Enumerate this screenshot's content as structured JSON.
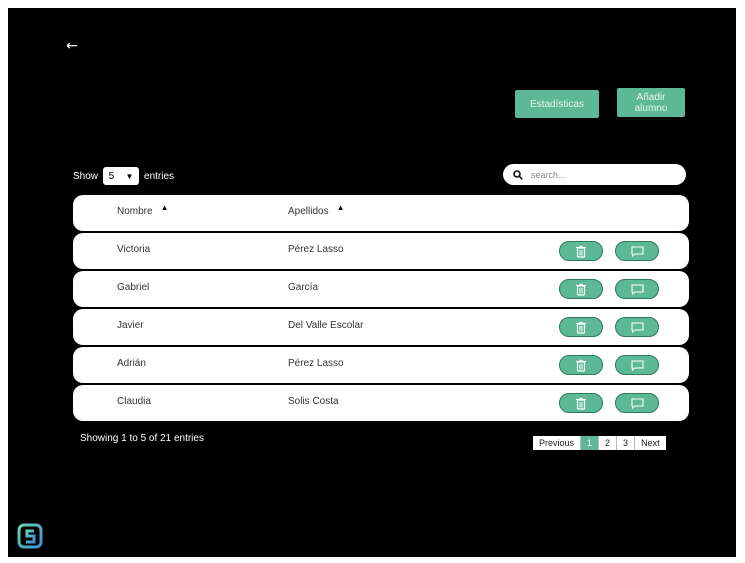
{
  "header": {
    "back_icon": "arrow-left-icon",
    "stats_label": "Estadísticas",
    "add_label": "Añadir alumno"
  },
  "controls": {
    "show_label": "Show",
    "entries_value": "5",
    "entries_label": "entries",
    "search_placeholder": "search..."
  },
  "table": {
    "columns": [
      "Nombre",
      "Apellidos"
    ],
    "rows": [
      {
        "nombre": "Victoria",
        "apellidos": "Pérez Lasso"
      },
      {
        "nombre": "Gabriel",
        "apellidos": "García"
      },
      {
        "nombre": "Javier",
        "apellidos": "Del Valle Escolar"
      },
      {
        "nombre": "Adrián",
        "apellidos": "Pérez Lasso"
      },
      {
        "nombre": "Claudia",
        "apellidos": "Solis Costa"
      }
    ]
  },
  "footer": {
    "info": "Showing 1 to 5 of 21 entries",
    "prev": "Previous",
    "pages": [
      "1",
      "2",
      "3"
    ],
    "next": "Next"
  },
  "colors": {
    "accent": "#5cb896",
    "background": "#000000"
  }
}
